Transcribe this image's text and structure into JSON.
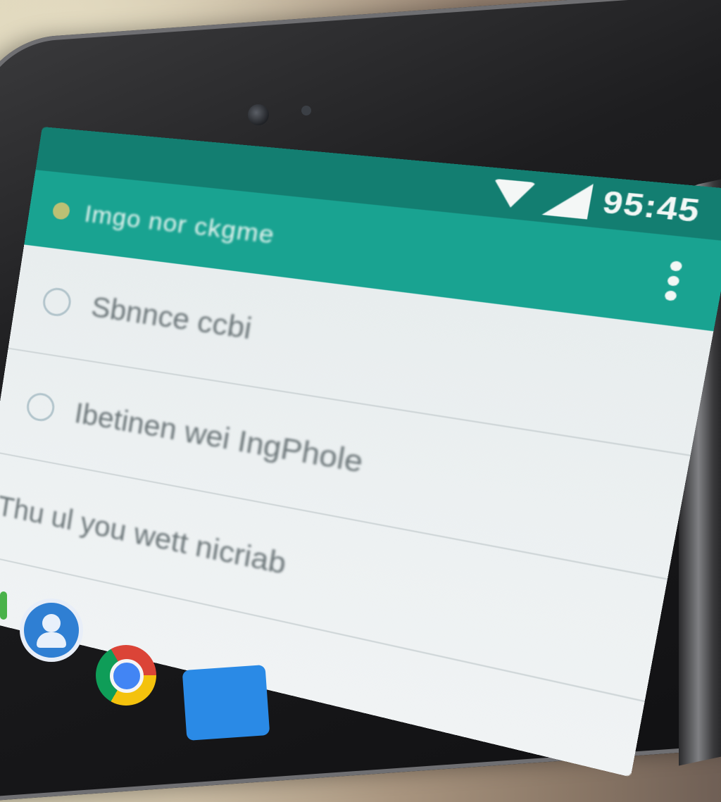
{
  "status_bar": {
    "time": "95:45",
    "icons": [
      "wifi-icon",
      "cell-signal-icon"
    ],
    "color": "#137e71"
  },
  "app_bar": {
    "title": "Imgo nor ckgme",
    "color": "#19a391",
    "menu_icon": "overflow-menu-icon"
  },
  "list": {
    "items": [
      {
        "label": "Sbnnce ccbi",
        "icon": "circle-icon"
      },
      {
        "label": "Ibetinen wei IngPhole",
        "icon": "circle-icon"
      },
      {
        "label": "Thu ul  you wett nicriab",
        "icon": ""
      }
    ]
  },
  "dock": {
    "icons": [
      "contacts-icon",
      "chrome-icon",
      "files-icon"
    ]
  }
}
